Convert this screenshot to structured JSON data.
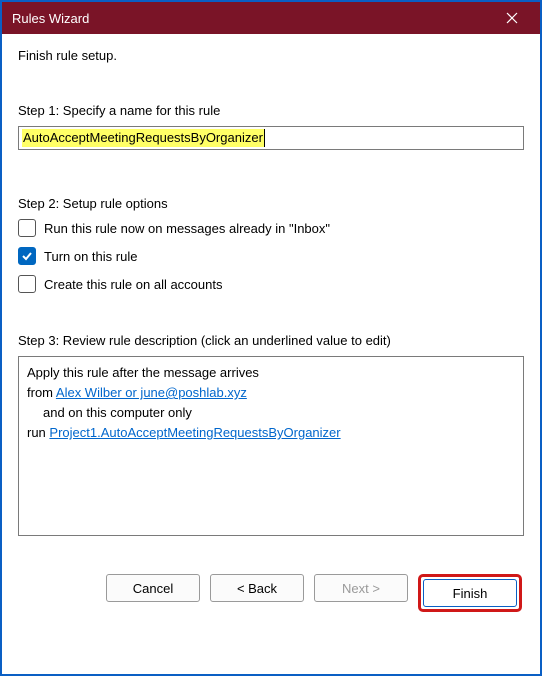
{
  "window": {
    "title": "Rules Wizard"
  },
  "instruction": "Finish rule setup.",
  "step1": {
    "label": "Step 1: Specify a name for this rule",
    "value": "AutoAcceptMeetingRequestsByOrganizer"
  },
  "step2": {
    "label": "Step 2: Setup rule options",
    "opt_run_now": "Run this rule now on messages already in \"Inbox\"",
    "opt_turn_on": "Turn on this rule",
    "opt_all_accounts": "Create this rule on all accounts",
    "checked": {
      "run_now": false,
      "turn_on": true,
      "all_accounts": false
    }
  },
  "step3": {
    "label": "Step 3: Review rule description (click an underlined value to edit)",
    "line1": "Apply this rule after the message arrives",
    "line2_prefix": "from ",
    "line2_link": "Alex Wilber or june@poshlab.xyz",
    "line3": "and on this computer only",
    "line4_prefix": "run ",
    "line4_link": "Project1.AutoAcceptMeetingRequestsByOrganizer"
  },
  "buttons": {
    "cancel": "Cancel",
    "back": "<  Back",
    "next": "Next  >",
    "finish": "Finish"
  }
}
